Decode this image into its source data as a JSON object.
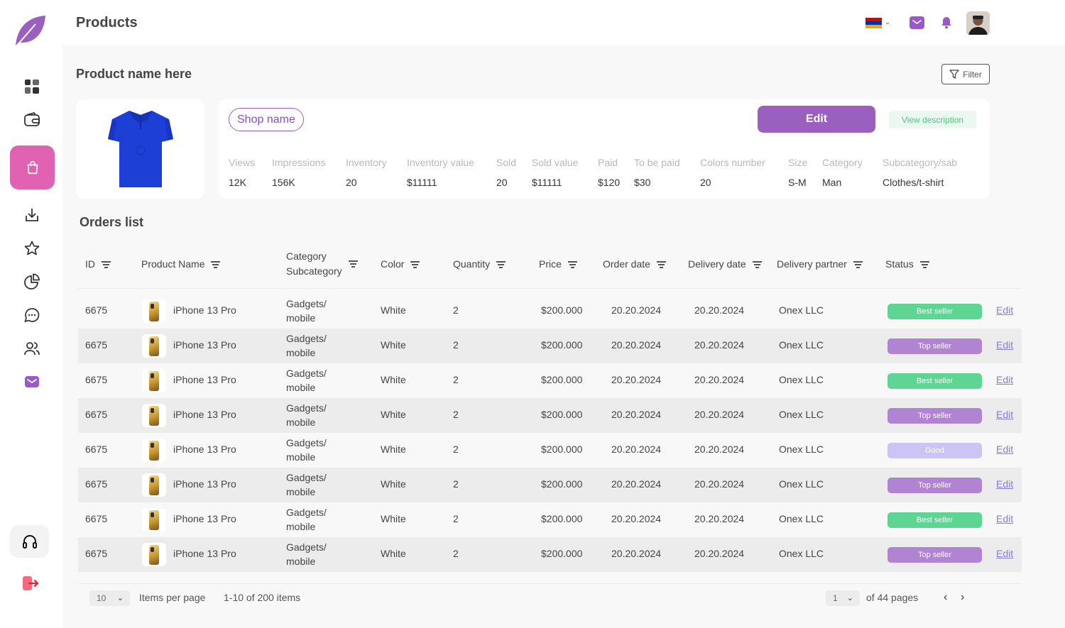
{
  "header": {
    "title": "Products"
  },
  "product": {
    "name": "Product name here",
    "filter_label": "Filter",
    "shop_name": "Shop name",
    "edit_label": "Edit",
    "view_description_label": "View  description",
    "stats": [
      {
        "label": "Views",
        "value": "12K"
      },
      {
        "label": "Impressions",
        "value": "156K"
      },
      {
        "label": "Inventory",
        "value": "20"
      },
      {
        "label": "Inventory value",
        "value": "$11111"
      },
      {
        "label": "Sold",
        "value": "20"
      },
      {
        "label": "Sold value",
        "value": "$11111"
      },
      {
        "label": "Paid",
        "value": "$120"
      },
      {
        "label": "To be paid",
        "value": "$30"
      },
      {
        "label": "Colors number",
        "value": "20"
      },
      {
        "label": "Size",
        "value": "S-M"
      },
      {
        "label": "Category",
        "value": "Man"
      },
      {
        "label": "Subcategory/sab",
        "value": "Clothes/t-shirt"
      }
    ]
  },
  "orders": {
    "title": "Orders list",
    "columns": [
      "ID",
      "Product Name",
      "Category\nSubcategory",
      "Color",
      "Quantity",
      "Price",
      "Order date",
      "Delivery date",
      "Delivery partner",
      "Status"
    ],
    "edit_label": "Edit",
    "rows": [
      {
        "id": "6675",
        "product": "iPhone 13 Pro",
        "category": "Gadgets/\nmobile",
        "color": "White",
        "quantity": "2",
        "price": "$200.000",
        "order_date": "20.20.2024",
        "delivery_date": "20.20.2024",
        "partner": "Onex LLC",
        "status": "Best seller"
      },
      {
        "id": "6675",
        "product": "iPhone 13 Pro",
        "category": "Gadgets/\nmobile",
        "color": "White",
        "quantity": "2",
        "price": "$200.000",
        "order_date": "20.20.2024",
        "delivery_date": "20.20.2024",
        "partner": "Onex LLC",
        "status": "Top seller"
      },
      {
        "id": "6675",
        "product": "iPhone 13 Pro",
        "category": "Gadgets/\nmobile",
        "color": "White",
        "quantity": "2",
        "price": "$200.000",
        "order_date": "20.20.2024",
        "delivery_date": "20.20.2024",
        "partner": "Onex LLC",
        "status": "Best seller"
      },
      {
        "id": "6675",
        "product": "iPhone 13 Pro",
        "category": "Gadgets/\nmobile",
        "color": "White",
        "quantity": "2",
        "price": "$200.000",
        "order_date": "20.20.2024",
        "delivery_date": "20.20.2024",
        "partner": "Onex LLC",
        "status": "Top seller"
      },
      {
        "id": "6675",
        "product": "iPhone 13 Pro",
        "category": "Gadgets/\nmobile",
        "color": "White",
        "quantity": "2",
        "price": "$200.000",
        "order_date": "20.20.2024",
        "delivery_date": "20.20.2024",
        "partner": "Onex LLC",
        "status": "Good"
      },
      {
        "id": "6675",
        "product": "iPhone 13 Pro",
        "category": "Gadgets/\nmobile",
        "color": "White",
        "quantity": "2",
        "price": "$200.000",
        "order_date": "20.20.2024",
        "delivery_date": "20.20.2024",
        "partner": "Onex LLC",
        "status": "Top seller"
      },
      {
        "id": "6675",
        "product": "iPhone 13 Pro",
        "category": "Gadgets/\nmobile",
        "color": "White",
        "quantity": "2",
        "price": "$200.000",
        "order_date": "20.20.2024",
        "delivery_date": "20.20.2024",
        "partner": "Onex LLC",
        "status": "Best seller"
      },
      {
        "id": "6675",
        "product": "iPhone 13 Pro",
        "category": "Gadgets/\nmobile",
        "color": "White",
        "quantity": "2",
        "price": "$200.000",
        "order_date": "20.20.2024",
        "delivery_date": "20.20.2024",
        "partner": "Onex LLC",
        "status": "Top seller"
      }
    ],
    "status_colors": {
      "Best seller": "#5fd594",
      "Top seller": "#b184d3",
      "Good": "#cbc4f5"
    }
  },
  "pagination": {
    "per_page": "10",
    "per_page_label": "Items per page",
    "range": "1-10 of 200 items",
    "current_page": "1",
    "of_pages": "of 44 pages"
  },
  "colors": {
    "accent": "#9b5fc0",
    "active_nav": "#e162b3",
    "mail": "#9b59c8"
  },
  "icons": {
    "sidebar": [
      "grid-icon",
      "wallet-icon",
      "shopping-bag-icon",
      "download-icon",
      "star-icon",
      "pie-chart-icon",
      "chat-icon",
      "users-icon",
      "mail-icon",
      "headphones-icon",
      "logout-icon"
    ],
    "topbar": [
      "armenia-flag-icon",
      "chevron-down-icon",
      "mail-icon",
      "bell-icon",
      "avatar"
    ]
  }
}
